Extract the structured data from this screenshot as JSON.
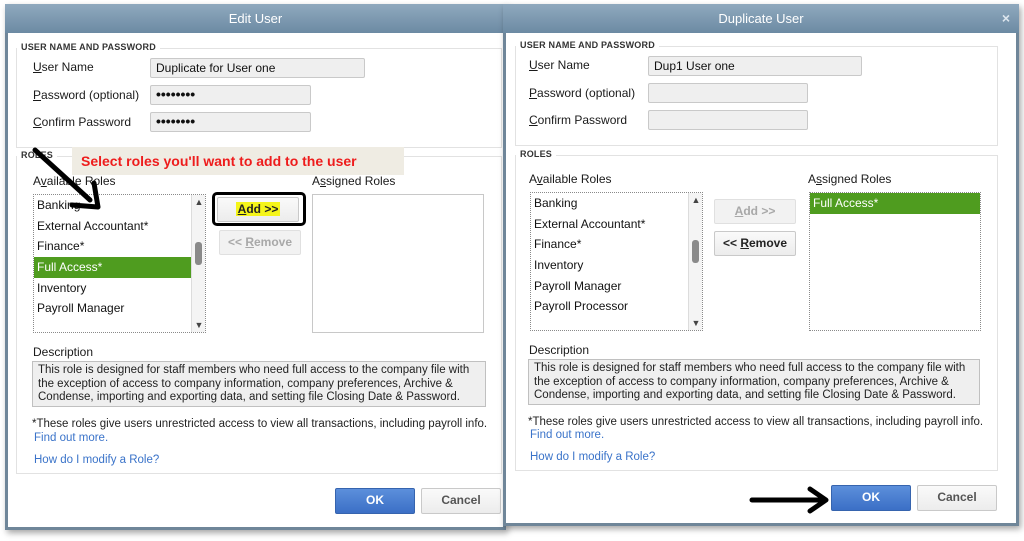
{
  "left_dialog": {
    "title": "Edit User",
    "user_section_legend": "USER NAME AND PASSWORD",
    "user_name_label_first": "U",
    "user_name_label_rest": "ser Name",
    "user_name_value": "Duplicate for User one",
    "password_label_first": "P",
    "password_label_rest": "assword (optional)",
    "password_value": "••••••••",
    "confirm_label_first": "C",
    "confirm_label_rest": "onfirm Password",
    "confirm_value": "••••••••",
    "roles_legend": "ROLES",
    "available_label_a": "A",
    "available_label_v": "v",
    "available_label_rest": "ailable Roles",
    "assigned_label_a": "A",
    "assigned_label_s": "s",
    "assigned_label_rest": "signed Roles",
    "available_roles": [
      "Banking",
      "External Accountant*",
      "Finance*",
      "Full Access*",
      "Inventory",
      "Payroll Manager"
    ],
    "selected_available_role": "Full Access*",
    "assigned_roles": [],
    "add_button_first": "A",
    "add_button_rest": "dd >>",
    "remove_button_prefix": "<< ",
    "remove_button_first": "R",
    "remove_button_rest": "emove",
    "description_label": "Description",
    "description_text": "This role is designed for staff members who need full access to the company file with the exception of access to company information, company preferences, Archive & Condense, importing and exporting data, and setting file Closing Date & Password.",
    "note": "*These roles give users unrestricted access to view all transactions, including payroll info.",
    "find_out_more": "Find out more.",
    "modify_role_link": "How do I modify a Role?",
    "ok_label": "OK",
    "cancel_label": "Cancel"
  },
  "right_dialog": {
    "title": "Duplicate User",
    "close_icon": "×",
    "user_section_legend": "USER NAME AND PASSWORD",
    "user_name_label_first": "U",
    "user_name_label_rest": "ser Name",
    "user_name_value": "Dup1 User one",
    "password_label_first": "P",
    "password_label_rest": "assword (optional)",
    "password_value": "",
    "confirm_label_first": "C",
    "confirm_label_rest": "onfirm Password",
    "confirm_value": "",
    "roles_legend": "ROLES",
    "available_label_a": "A",
    "available_label_v": "v",
    "available_label_rest": "ailable Roles",
    "assigned_label_a": "A",
    "assigned_label_s": "s",
    "assigned_label_rest": "signed Roles",
    "available_roles": [
      "Banking",
      "External Accountant*",
      "Finance*",
      "Inventory",
      "Payroll Manager",
      "Payroll Processor"
    ],
    "assigned_roles": [
      "Full Access*"
    ],
    "selected_assigned_role": "Full Access*",
    "add_button_first": "A",
    "add_button_rest": "dd >>",
    "remove_button_prefix": "<< ",
    "remove_button_first": "R",
    "remove_button_rest": "emove",
    "description_label": "Description",
    "description_text": "This role is designed for staff members who need full access to the company file with the exception of access to company information, company preferences, Archive & Condense, importing and exporting data, and setting file Closing Date & Password.",
    "note": "*These roles give users unrestricted access to view all transactions, including payroll info.",
    "find_out_more": "Find out more.",
    "modify_role_link": "How do I modify a Role?",
    "ok_label": "OK",
    "cancel_label": "Cancel"
  },
  "annotation": {
    "callout_text": "Select roles you'll want to add to the user",
    "arrow_to_list": "arrow-pointing-to-available-roles",
    "arrow_to_ok": "arrow-pointing-to-ok-button"
  },
  "colors": {
    "selection_green": "#4f9c1f",
    "titlebar_blue": "#7893aa",
    "primary_button_blue": "#4a7fd0",
    "link_blue": "#3a73c9",
    "callout_red": "#ee1c1c",
    "highlight_yellow": "#f5f51a"
  }
}
